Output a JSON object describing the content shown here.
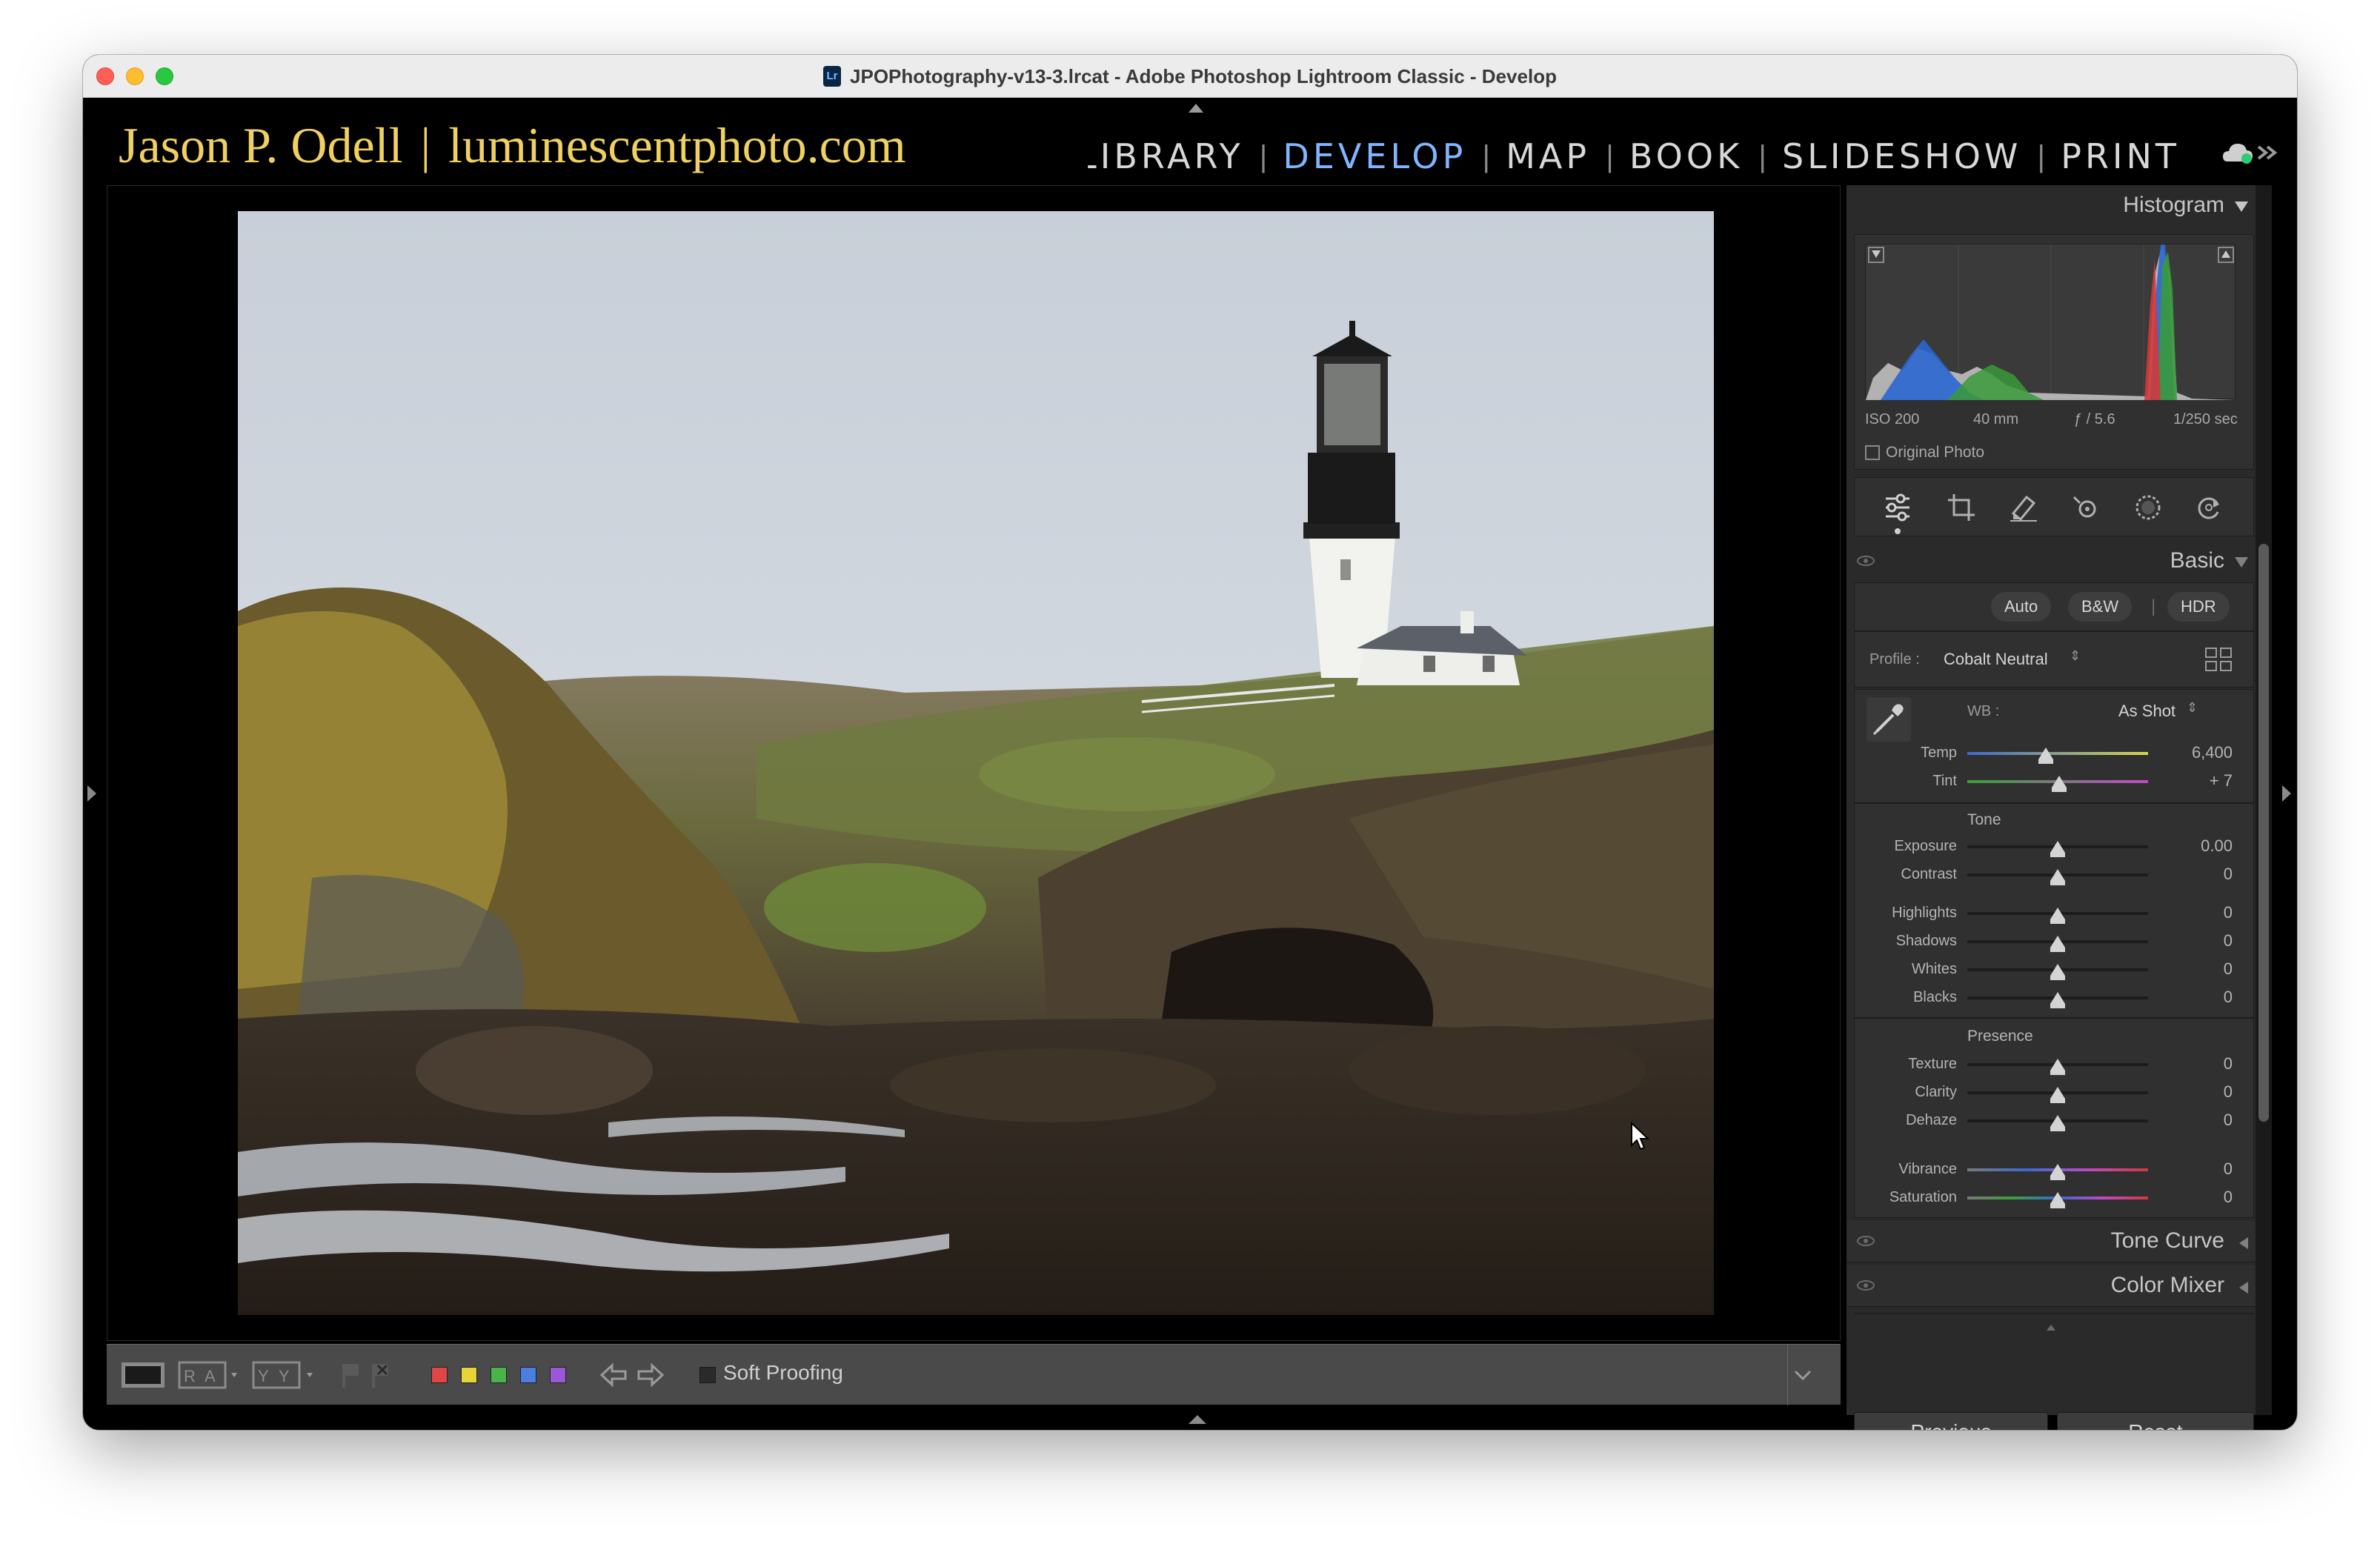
{
  "window": {
    "title": "JPOPhotography-v13-3.lrcat - Adobe Photoshop Lightroom Classic - Develop",
    "app_icon": "Lr"
  },
  "identity": {
    "name": "Jason P. Odell",
    "separator": "|",
    "site": "luminescentphoto.com"
  },
  "modules": {
    "items": [
      {
        "label": "LIBRARY",
        "active": false
      },
      {
        "label": "DEVELOP",
        "active": true
      },
      {
        "label": "MAP",
        "active": false
      },
      {
        "label": "BOOK",
        "active": false
      },
      {
        "label": "SLIDESHOW",
        "active": false
      },
      {
        "label": "PRINT",
        "active": false
      }
    ],
    "divider": "|",
    "cloud_icon": "cloud-sync-icon",
    "more_icon": "chevron-double-right-icon"
  },
  "histogram": {
    "title": "Histogram",
    "iso": "ISO 200",
    "focal": "40 mm",
    "aperture": "ƒ / 5.6",
    "shutter": "1/250 sec",
    "original_photo_label": "Original Photo"
  },
  "tools": [
    "edit-sliders-icon",
    "crop-icon",
    "healing-icon",
    "red-eye-icon",
    "masking-icon",
    "reset-icon"
  ],
  "basic": {
    "title": "Basic",
    "auto": "Auto",
    "bw": "B&W",
    "divider": "|",
    "hdr": "HDR",
    "profile_label": "Profile :",
    "profile_value": "Cobalt Neutral",
    "wb_label": "WB :",
    "wb_value": "As Shot",
    "temp_label": "Temp",
    "temp_value": "6,400",
    "tint_label": "Tint",
    "tint_value": "+ 7",
    "tone_title": "Tone",
    "presence_title": "Presence",
    "sliders": [
      {
        "label": "Exposure",
        "value": "0.00"
      },
      {
        "label": "Contrast",
        "value": "0"
      },
      {
        "label": "Highlights",
        "value": "0"
      },
      {
        "label": "Shadows",
        "value": "0"
      },
      {
        "label": "Whites",
        "value": "0"
      },
      {
        "label": "Blacks",
        "value": "0"
      },
      {
        "label": "Texture",
        "value": "0"
      },
      {
        "label": "Clarity",
        "value": "0"
      },
      {
        "label": "Dehaze",
        "value": "0"
      },
      {
        "label": "Vibrance",
        "value": "0"
      },
      {
        "label": "Saturation",
        "value": "0"
      }
    ]
  },
  "panels": {
    "tone_curve": "Tone Curve",
    "color_mixer": "Color Mixer"
  },
  "buttons": {
    "previous": "Previous",
    "reset": "Reset"
  },
  "toolbar": {
    "soft_proofing": "Soft Proofing",
    "view_icons": [
      "loupe-view-icon",
      "before-after-ra-icon",
      "before-after-yy-icon"
    ],
    "flag_icons": [
      "flag-icon",
      "reject-flag-icon"
    ],
    "color_labels": [
      "#e04646",
      "#e6d43a",
      "#4ab44a",
      "#4a7ee0",
      "#9a58d8"
    ],
    "nav_icons": [
      "arrow-left-icon",
      "arrow-right-icon"
    ]
  }
}
